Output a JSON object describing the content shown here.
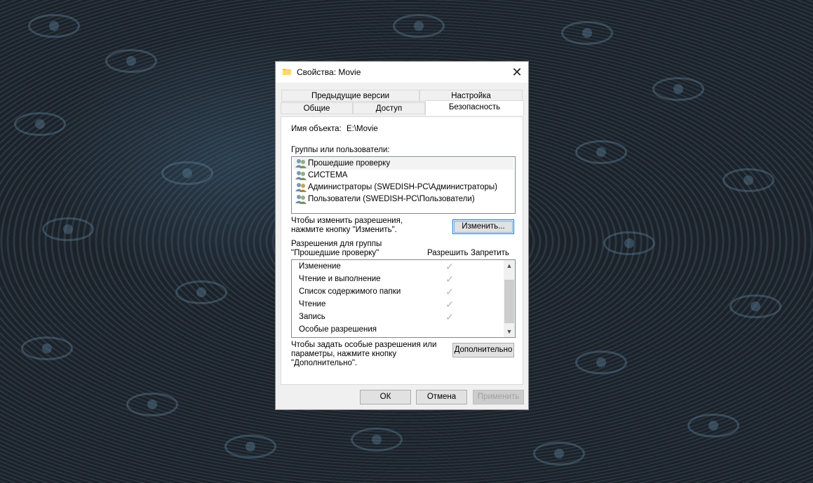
{
  "window": {
    "title": "Свойства: Movie",
    "close_glyph": "✕"
  },
  "tabs": {
    "row_back": [
      "Предыдущие версии",
      "Настройка"
    ],
    "row_front": [
      "Общие",
      "Доступ",
      "Безопасность"
    ],
    "active": "Безопасность"
  },
  "security": {
    "object_name_label": "Имя объекта:",
    "object_name_value": "E:\\Movie",
    "groups_label": "Группы или пользователи:",
    "groups": [
      "Прошедшие проверку",
      "СИСТЕМА",
      "Администраторы (SWEDISH-PC\\Администраторы)",
      "Пользователи (SWEDISH-PC\\Пользователи)"
    ],
    "change_hint_line1": "Чтобы изменить разрешения,",
    "change_hint_line2": "нажмите кнопку \"Изменить\".",
    "change_button": "Изменить...",
    "perm_group_line1": "Разрешения для группы",
    "perm_group_line2": "\"Прошедшие проверку\"",
    "allow_col": "Разрешить",
    "deny_col": "Запретить",
    "permissions": [
      {
        "name": "Изменение",
        "allow": true
      },
      {
        "name": "Чтение и выполнение",
        "allow": true
      },
      {
        "name": "Список содержимого папки",
        "allow": true
      },
      {
        "name": "Чтение",
        "allow": true
      },
      {
        "name": "Запись",
        "allow": true
      },
      {
        "name": "Особые разрешения",
        "allow": false
      }
    ],
    "check_glyph": "✓",
    "advanced_hint_line1": "Чтобы задать особые разрешения или",
    "advanced_hint_line2": "параметры, нажмите кнопку",
    "advanced_hint_line3": "\"Дополнительно\".",
    "advanced_button": "Дополнительно"
  },
  "footer": {
    "ok": "ОК",
    "cancel": "Отмена",
    "apply": "Применить"
  },
  "colors": {
    "accent": "#0078d7",
    "folder": "#f4c443"
  }
}
